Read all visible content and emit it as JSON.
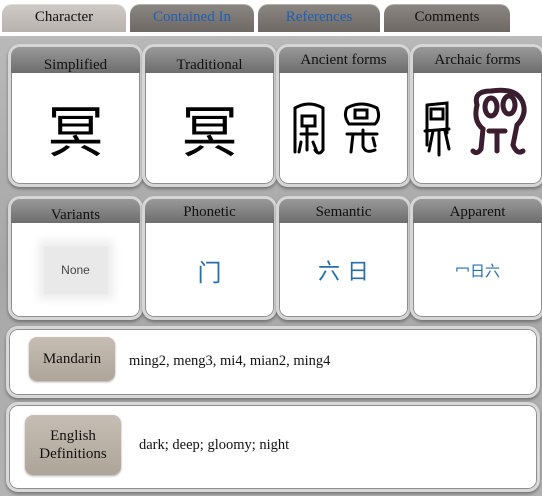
{
  "tabs": [
    {
      "label": "Character",
      "state": "active"
    },
    {
      "label": "Contained In",
      "state": "link"
    },
    {
      "label": "References",
      "state": "link"
    },
    {
      "label": "Comments",
      "state": "dark"
    }
  ],
  "forms": {
    "simplified": {
      "label": "Simplified",
      "char": "冥"
    },
    "traditional": {
      "label": "Traditional",
      "char": "冥"
    },
    "ancient": {
      "label": "Ancient forms"
    },
    "archaic": {
      "label": "Archaic forms"
    }
  },
  "components": {
    "variants": {
      "label": "Variants",
      "value": "None"
    },
    "phonetic": {
      "label": "Phonetic",
      "value": "门"
    },
    "semantic": {
      "label": "Semantic",
      "value": "六 日"
    },
    "apparent": {
      "label": "Apparent",
      "value": "冖日六"
    }
  },
  "mandarin": {
    "label": "Mandarin",
    "value": "ming2, meng3, mi4, mian2, ming4"
  },
  "english": {
    "label_line1": "English",
    "label_line2": "Definitions",
    "value": "dark; deep; gloomy; night"
  },
  "colors": {
    "link": "#1f5fb3",
    "component": "#2a6ea8",
    "pill": "#b8b0a4"
  }
}
